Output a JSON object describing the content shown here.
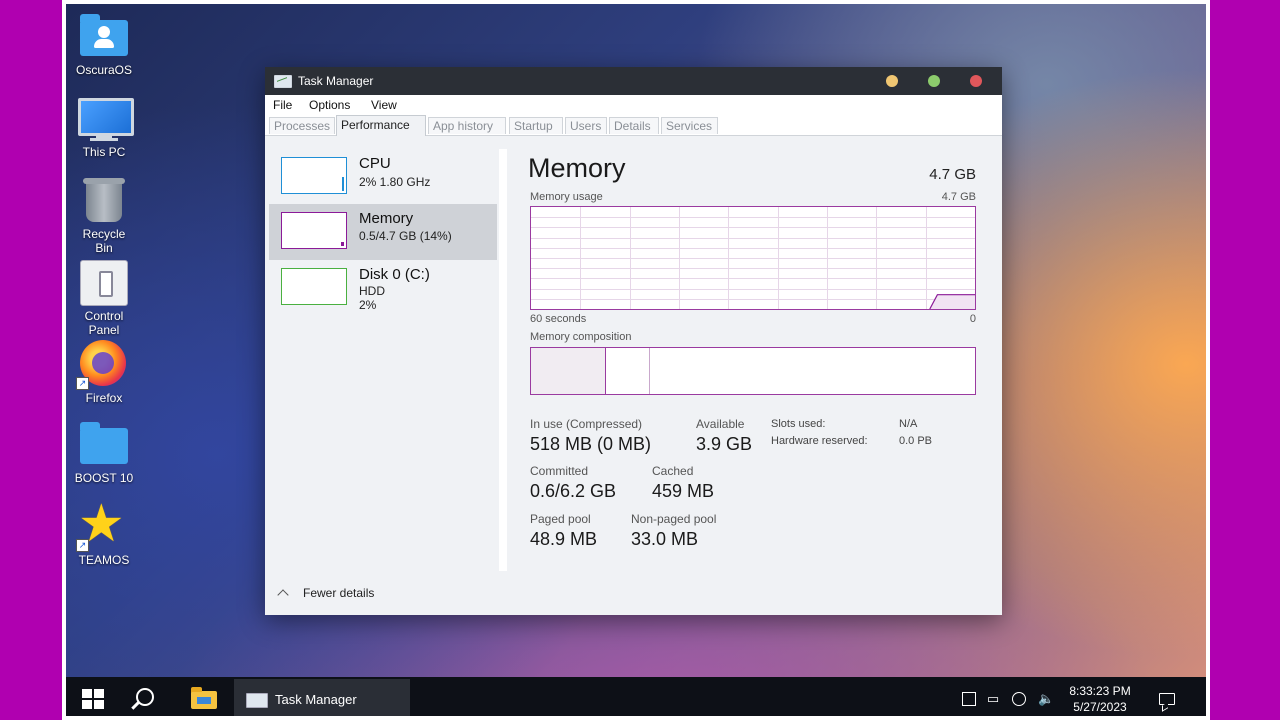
{
  "desktop": {
    "icons": [
      {
        "label": "OscuraOS",
        "icon": "user-folder-icon"
      },
      {
        "label": "This PC",
        "icon": "computer-icon"
      },
      {
        "label": "Recycle Bin",
        "icon": "recycle-bin-icon"
      },
      {
        "label": "Control Panel",
        "icon": "control-panel-icon"
      },
      {
        "label": "Firefox",
        "icon": "firefox-icon"
      },
      {
        "label": "BOOST 10",
        "icon": "folder-icon"
      },
      {
        "label": "TEAMOS",
        "icon": "star-icon"
      }
    ]
  },
  "window": {
    "title": "Task Manager",
    "menu": [
      "File",
      "Options",
      "View"
    ],
    "tabs": [
      "Processes",
      "Performance",
      "App history",
      "Startup",
      "Users",
      "Details",
      "Services"
    ],
    "active_tab": "Performance",
    "sidebar": [
      {
        "name": "CPU",
        "line1": "2%  1.80 GHz",
        "line2": "",
        "color": "#1f8fd6"
      },
      {
        "name": "Memory",
        "line1": "0.5/4.7 GB (14%)",
        "line2": "",
        "color": "#8b1a98"
      },
      {
        "name": "Disk 0 (C:)",
        "line1": "HDD",
        "line2": "2%",
        "color": "#4ab040"
      }
    ],
    "memory": {
      "title": "Memory",
      "total": "4.7 GB",
      "usage_label": "Memory usage",
      "usage_max": "4.7 GB",
      "axis_left": "60 seconds",
      "axis_right": "0",
      "composition_label": "Memory composition",
      "stats": {
        "in_use_label": "In use (Compressed)",
        "in_use_value": "518 MB (0 MB)",
        "available_label": "Available",
        "available_value": "3.9 GB",
        "committed_label": "Committed",
        "committed_value": "0.6/6.2 GB",
        "cached_label": "Cached",
        "cached_value": "459 MB",
        "paged_label": "Paged pool",
        "paged_value": "48.9 MB",
        "nonpaged_label": "Non-paged pool",
        "nonpaged_value": "33.0 MB",
        "slots_label": "Slots used:",
        "slots_value": "N/A",
        "hw_reserved_label": "Hardware reserved:",
        "hw_reserved_value": "0.0 PB"
      },
      "usage_history_fraction": [
        0,
        0,
        0,
        0,
        0,
        0,
        0,
        0,
        0,
        0,
        0,
        0,
        0,
        0,
        0,
        0,
        0,
        0,
        0,
        0,
        0,
        0,
        0,
        0,
        0,
        0,
        0,
        0,
        0,
        0,
        0,
        0,
        0,
        0,
        0,
        0,
        0,
        0,
        0,
        0,
        0,
        0,
        0,
        0,
        0,
        0,
        0,
        0,
        0,
        0,
        0,
        0,
        0,
        0,
        0.14,
        0.14,
        0.14,
        0.14,
        0.14,
        0.14
      ],
      "composition_fraction": {
        "in_use": 0.17,
        "modified": 0.1
      }
    },
    "footer": "Fewer details"
  },
  "taskbar": {
    "app_label": "Task Manager",
    "time": "8:33:23 PM",
    "date": "5/27/2023"
  },
  "colors": {
    "memory_accent": "#8b1a98",
    "cpu_accent": "#1f8fd6",
    "disk_accent": "#4ab040"
  }
}
